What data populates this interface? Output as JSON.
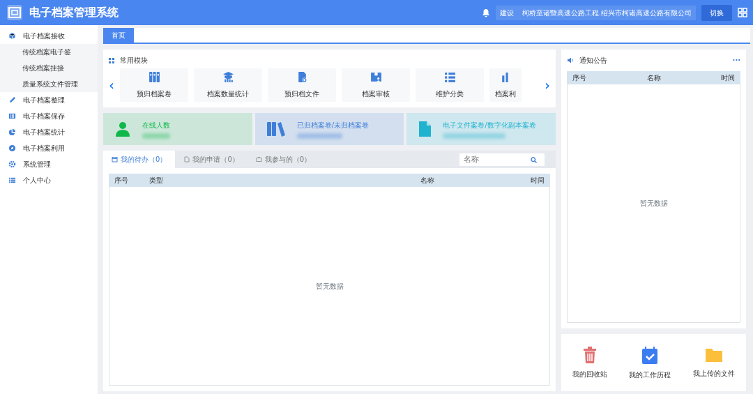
{
  "header": {
    "title": "电子档案管理系统",
    "role": "建设",
    "project": "柯桥至诸暨高速公路工程.绍兴市柯诸高速公路有限公司",
    "switch_button": "切换"
  },
  "sidebar": {
    "items": [
      {
        "label": "电子档案接收",
        "children": [
          {
            "label": "传统档案电子签"
          },
          {
            "label": "传统档案挂接"
          },
          {
            "label": "质量系统文件管理"
          }
        ]
      },
      {
        "label": "电子档案整理"
      },
      {
        "label": "电子档案保存"
      },
      {
        "label": "电子档案统计"
      },
      {
        "label": "电子档案利用"
      },
      {
        "label": "系统管理"
      },
      {
        "label": "个人中心"
      }
    ]
  },
  "page_tabs": [
    {
      "label": "首页",
      "selected": true
    }
  ],
  "modules": {
    "title": "常用模块",
    "prev": "‹",
    "next": "›",
    "items": [
      {
        "label": "预归档案卷"
      },
      {
        "label": "档案数量统计"
      },
      {
        "label": "预归档文件"
      },
      {
        "label": "档案审核"
      },
      {
        "label": "维护分类"
      },
      {
        "label": "档案利"
      }
    ]
  },
  "stats": [
    {
      "label": "在线人数",
      "color": "#10b84a"
    },
    {
      "label": "已归档案卷/未归档案卷",
      "color": "#3f7fd9"
    },
    {
      "label": "电子文件案卷/数字化副本案卷",
      "color": "#1fb3d0"
    }
  ],
  "work_tabs": [
    {
      "label": "我的待办（0）",
      "selected": true
    },
    {
      "label": "我的申请（0）",
      "selected": false
    },
    {
      "label": "我参与的（0）",
      "selected": false
    }
  ],
  "search": {
    "placeholder": "名称"
  },
  "work_table": {
    "columns": [
      "序号",
      "类型",
      "名称",
      "时间"
    ],
    "empty": "暂无数据"
  },
  "notice": {
    "title": "通知公告",
    "more": "···",
    "columns": [
      "序号",
      "名称",
      "时间"
    ],
    "empty": "暂无数据"
  },
  "shortcuts": [
    {
      "label": "我的回收站"
    },
    {
      "label": "我的工作历程"
    },
    {
      "label": "我上传的文件"
    }
  ]
}
